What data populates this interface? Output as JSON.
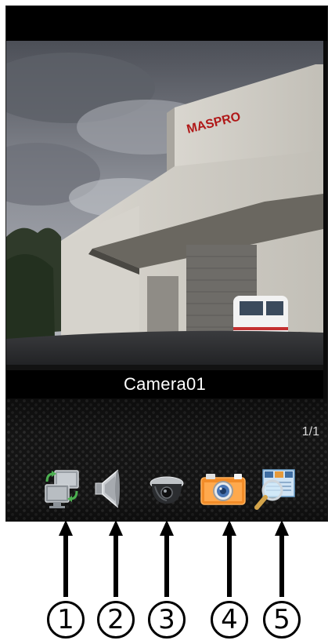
{
  "viewer": {
    "camera_name": "Camera01",
    "page_indicator": "1/1",
    "building_sign": "MASPRO"
  },
  "toolbar": {
    "buttons": [
      {
        "icon": "switch-screens-icon"
      },
      {
        "icon": "speaker-icon"
      },
      {
        "icon": "dome-camera-icon"
      },
      {
        "icon": "snapshot-camera-icon"
      },
      {
        "icon": "search-zoom-icon"
      }
    ]
  },
  "callouts": [
    "1",
    "2",
    "3",
    "4",
    "5"
  ]
}
